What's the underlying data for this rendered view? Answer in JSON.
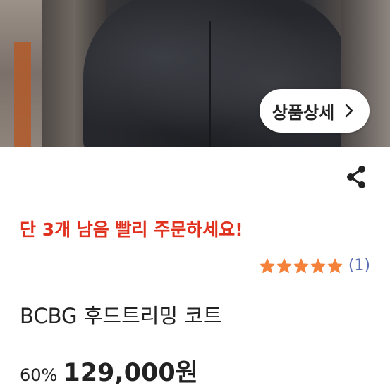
{
  "product_image": {
    "detail_button_label": "상품상세"
  },
  "stock_notice": "단 3개 남음 빨리 주문하세요!",
  "rating": {
    "stars": 5,
    "max_stars": 5,
    "count_label": "(1)",
    "star_color": "#f5823a"
  },
  "product": {
    "title": "BCBG 후드트리밍 코트",
    "discount": "60%",
    "price": "129,000원"
  },
  "colors": {
    "notice": "#e0301e",
    "rating_count": "#5b6fb3"
  },
  "icons": {
    "share": "share-icon",
    "chevron": "chevron-right-icon",
    "star": "star-icon"
  }
}
